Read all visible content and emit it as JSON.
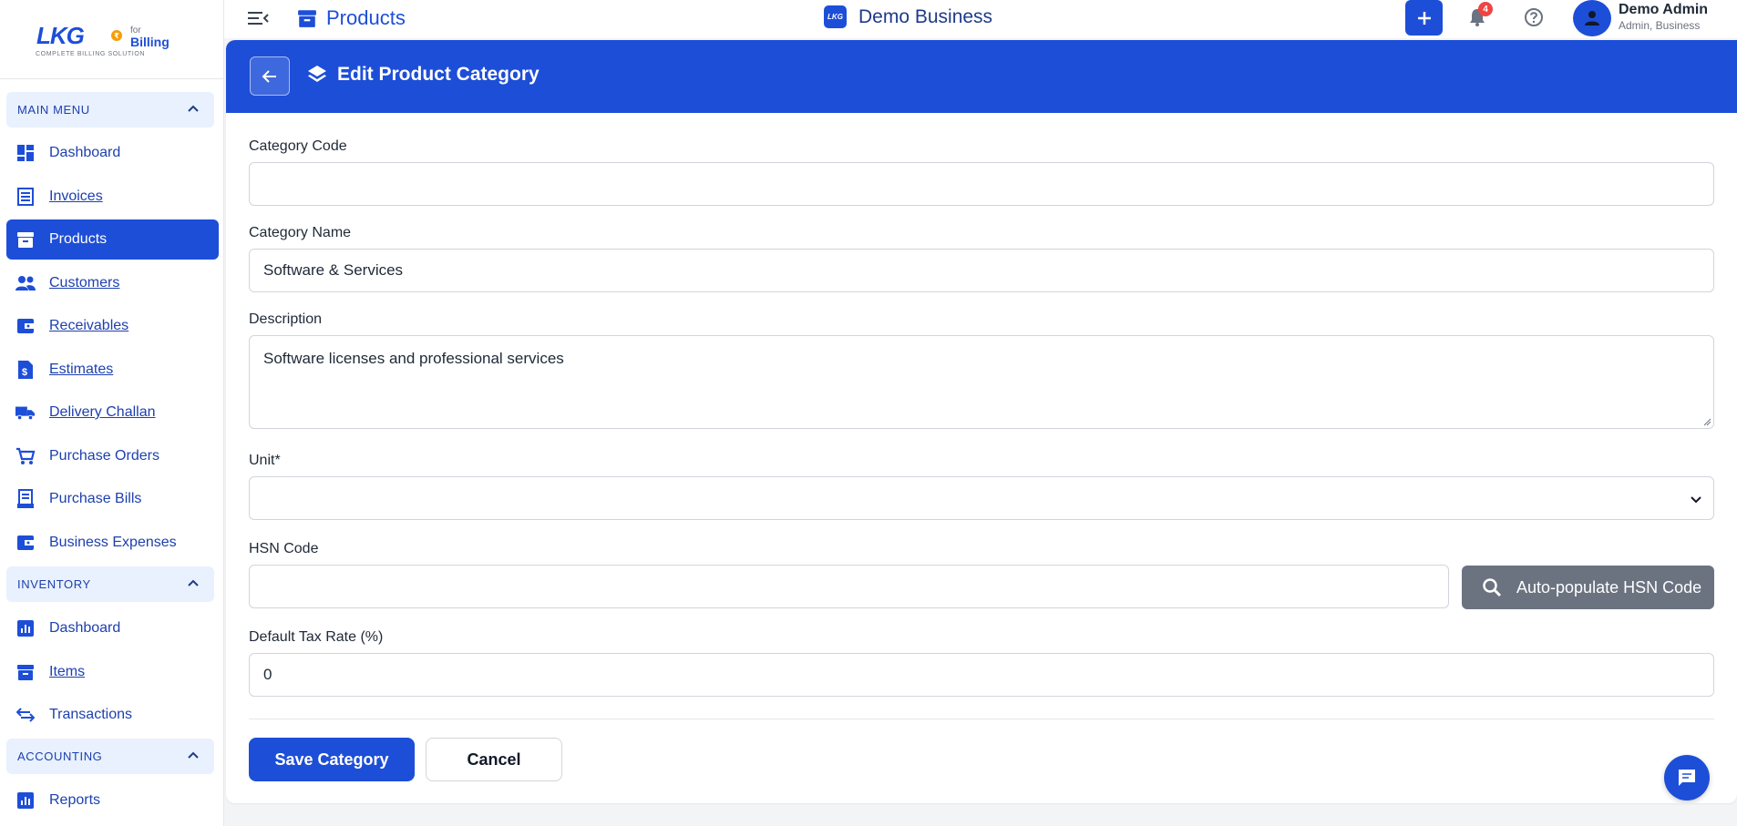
{
  "brand": {
    "logo": "LKG",
    "tagline": "COMPLETE BILLING SOLUTION",
    "for": "for",
    "product": "Billing"
  },
  "sidebar": {
    "main_menu": {
      "header": "MAIN MENU",
      "items": [
        {
          "label": "Dashboard",
          "icon": "dashboard-icon"
        },
        {
          "label": "Invoices",
          "icon": "receipt-icon"
        },
        {
          "label": "Products",
          "icon": "archive-box-icon",
          "active": true
        },
        {
          "label": "Customers",
          "icon": "people-icon"
        },
        {
          "label": "Receivables",
          "icon": "wallet-icon"
        },
        {
          "label": "Estimates",
          "icon": "estimate-document-icon"
        },
        {
          "label": "Delivery Challan",
          "icon": "truck-icon"
        },
        {
          "label": "Purchase Orders",
          "icon": "cart-icon"
        },
        {
          "label": "Purchase Bills",
          "icon": "bill-icon"
        },
        {
          "label": "Business Expenses",
          "icon": "wallet-icon"
        }
      ]
    },
    "inventory": {
      "header": "INVENTORY",
      "items": [
        {
          "label": "Dashboard",
          "icon": "bar-chart-icon"
        },
        {
          "label": "Items",
          "icon": "archive-box-icon"
        },
        {
          "label": "Transactions",
          "icon": "swap-arrows-icon"
        }
      ]
    },
    "accounting": {
      "header": "ACCOUNTING",
      "items": [
        {
          "label": "Reports",
          "icon": "bar-chart-icon"
        }
      ]
    }
  },
  "topbar": {
    "title": "Products",
    "business_logo": "LKG",
    "business_name": "Demo Business",
    "notification_count": "4",
    "user_name": "Demo Admin",
    "user_role": "Admin, Business"
  },
  "form": {
    "title": "Edit Product Category",
    "category_code": {
      "label": "Category Code",
      "value": ""
    },
    "category_name": {
      "label": "Category Name",
      "value": "Software & Services"
    },
    "description": {
      "label": "Description",
      "value": "Software licenses and professional services"
    },
    "unit": {
      "label": "Unit*",
      "value": ""
    },
    "hsn_code": {
      "label": "HSN Code",
      "value": "",
      "button": "Auto-populate HSN Code"
    },
    "tax_rate": {
      "label": "Default Tax Rate (%)",
      "value": "0"
    },
    "save_label": "Save Category",
    "cancel_label": "Cancel"
  },
  "colors": {
    "primary": "#1d4ed8",
    "section_bg": "#e8f1fd",
    "secondary_button": "#6b7280",
    "badge": "#ef4444"
  }
}
